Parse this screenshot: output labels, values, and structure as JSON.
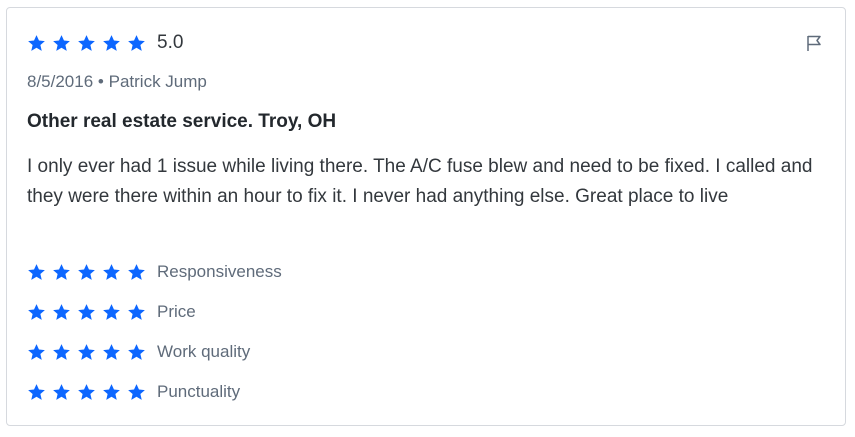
{
  "review": {
    "overall_rating": 5.0,
    "rating_text": "5.0",
    "date": "8/5/2016",
    "separator": "•",
    "author": "Patrick Jump",
    "title": "Other real estate service. Troy, OH",
    "body": "I only ever had 1 issue while living there. The A/C fuse blew and need to be fixed. I called and they were there within an hour to fix it. I never had anything else. Great place to live",
    "sub_ratings": [
      {
        "label": "Responsiveness",
        "stars": 5
      },
      {
        "label": "Price",
        "stars": 5
      },
      {
        "label": "Work quality",
        "stars": 5
      },
      {
        "label": "Punctuality",
        "stars": 5
      }
    ]
  },
  "icons": {
    "star": "star-icon",
    "flag": "flag-icon"
  },
  "colors": {
    "star": "#0c66ff",
    "text": "#33383d",
    "muted": "#5f6b7a",
    "border": "#d6d9de"
  }
}
